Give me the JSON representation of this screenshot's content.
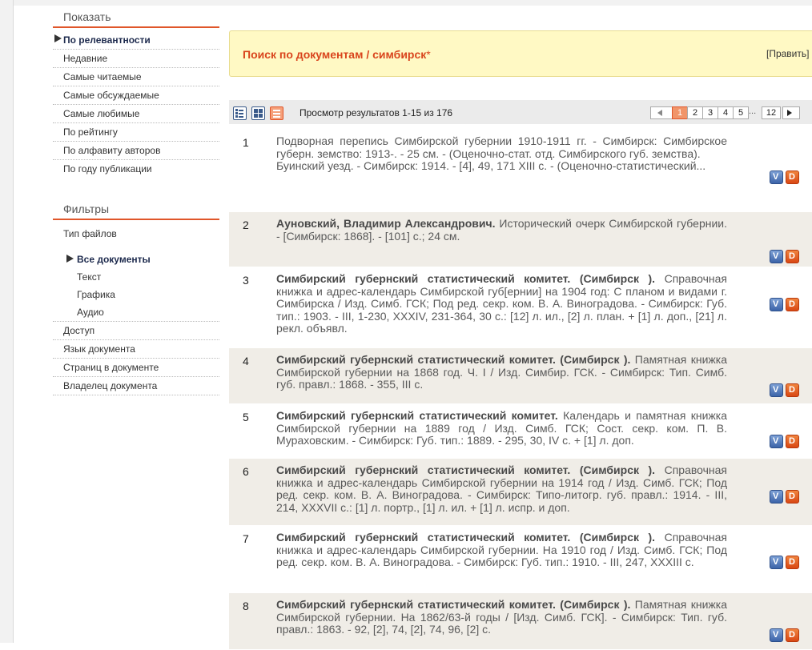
{
  "sidebar": {
    "show_heading": "Показать",
    "sort_items": [
      {
        "label": "По релевантности",
        "active": true
      },
      {
        "label": "Недавние"
      },
      {
        "label": "Самые читаемые"
      },
      {
        "label": "Самые обсуждаемые"
      },
      {
        "label": "Самые любимые"
      },
      {
        "label": "По рейтингу"
      },
      {
        "label": "По алфавиту авторов"
      },
      {
        "label": "По году публикации"
      }
    ],
    "filters_heading": "Фильтры",
    "file_type_label": "Тип файлов",
    "file_types": [
      {
        "label": "Все документы",
        "active": true
      },
      {
        "label": "Текст"
      },
      {
        "label": "Графика"
      },
      {
        "label": "Аудио"
      }
    ],
    "other_filters": [
      "Доступ",
      "Язык документа",
      "Страниц в документе",
      "Владелец документа"
    ]
  },
  "search": {
    "title": "Поиск по документам / симбирск",
    "star": "*",
    "edit_label": "[Править]"
  },
  "toolbar": {
    "showing": "Просмотр результатов 1-15 из 176",
    "pages": [
      "1",
      "2",
      "3",
      "4",
      "5",
      "12"
    ],
    "ellipsis": "...",
    "current_page": "1"
  },
  "results": [
    {
      "num": "1",
      "author": "",
      "text": "Подворная перепись Симбирской губернии 1910-1911 гг. - Симбирск: Симбирское губерн. земство: 1913-. - 25 см. - (Оценочно-стат. отд. Симбирского губ. земства).",
      "text2": "Буинский уезд. - Симбирск: 1914. - [4], 49, 171 XIII с. - (Оценочно-статистический..."
    },
    {
      "num": "2",
      "author": "Ауновский, Владимир Александрович.",
      "text": "Исторический очерк Симбирской губернии. - [Симбирск: 1868]. - [101] с.; 24 см.",
      "text2": ""
    },
    {
      "num": "3",
      "author": "Симбирский губернский статистический комитет. (Симбирск ).",
      "text": "Справочная книжка и адрес-календарь Симбирской губ[ернии] на 1904 год: С планом и видами г. Симбирска / Изд. Симб. ГСК; Под ред. секр. ком. В. А. Виноградова. - Симбирск: Губ. тип.: 1903. - III, 1-230, XXXIV, 231-364, 30 с.: [12] л. ил., [2] л. план. + [1] л. доп., [21] л. рекл. объявл.",
      "text2": ""
    },
    {
      "num": "4",
      "author": "Симбирский губернский статистический комитет. (Симбирск ).",
      "text": "Памятная книжка Симбирской губернии на 1868 год. Ч. I / Изд. Симбир. ГСК. - Симбирск: Тип. Симб. губ. правл.: 1868. - 355, III с.",
      "text2": ""
    },
    {
      "num": "5",
      "author": "Симбирский губернский статистический комитет.",
      "text": "Календарь и памятная книжка Симбирской губернии на 1889 год / Изд. Симб. ГСК; Сост. секр. ком. П. В. Мураховским. - Симбирск: Губ. тип.: 1889. - 295, 30, IV с. + [1] л. доп.",
      "text2": ""
    },
    {
      "num": "6",
      "author": "Симбирский губернский статистический комитет. (Симбирск ).",
      "text": "Справочная книжка и адрес-календарь Симбирской губернии на 1914 год / Изд. Симб. ГСК; Под ред. секр. ком. В. А. Виноградова. - Симбирск: Типо-литогр. губ. правл.: 1914. - III, 214, XXXVII с.: [1] л. портр., [1] л. ил. + [1] л. испр. и доп.",
      "text2": ""
    },
    {
      "num": "7",
      "author": "Симбирский губернский статистический комитет. (Симбирск ).",
      "text": "Справочная книжка и адрес-календарь Симбирской губернии. На 1910 год / Изд. Симб. ГСК; Под ред. секр. ком. В. А. Виноградова. - Симбирск: Губ. тип.: 1910. - III, 247, XXXIII с.",
      "text2": ""
    },
    {
      "num": "8",
      "author": "Симбирский губернский статистический комитет. (Симбирск ).",
      "text": "Памятная книжка Симбирской губернии. На 1862/63-й годы / [Изд. Симб. ГСК]. - Симбирск: Тип. губ. правл.: 1863. - 92, [2], 74, [2], 74, 96, [2] с.",
      "text2": ""
    }
  ],
  "colors": {
    "accent": "#e0562a",
    "search_bg": "#fff9c4",
    "row_alt": "#f0ede7"
  }
}
